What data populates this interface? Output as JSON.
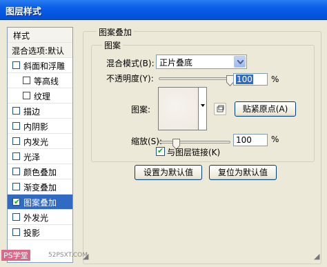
{
  "window": {
    "title": "图层样式"
  },
  "styles_panel": {
    "header_label": "样式",
    "blend_label": "混合选项:默认",
    "items": [
      {
        "label": "斜面和浮雕",
        "checked": false,
        "indent": false,
        "selected": false
      },
      {
        "label": "等高线",
        "checked": false,
        "indent": true,
        "selected": false
      },
      {
        "label": "纹理",
        "checked": false,
        "indent": true,
        "selected": false
      },
      {
        "label": "描边",
        "checked": false,
        "indent": false,
        "selected": false
      },
      {
        "label": "内阴影",
        "checked": false,
        "indent": false,
        "selected": false
      },
      {
        "label": "内发光",
        "checked": false,
        "indent": false,
        "selected": false
      },
      {
        "label": "光泽",
        "checked": false,
        "indent": false,
        "selected": false
      },
      {
        "label": "颜色叠加",
        "checked": false,
        "indent": false,
        "selected": false
      },
      {
        "label": "渐变叠加",
        "checked": false,
        "indent": false,
        "selected": false
      },
      {
        "label": "图案叠加",
        "checked": true,
        "indent": false,
        "selected": true
      },
      {
        "label": "外发光",
        "checked": false,
        "indent": false,
        "selected": false
      },
      {
        "label": "投影",
        "checked": false,
        "indent": false,
        "selected": false
      }
    ]
  },
  "pattern_overlay": {
    "group_title": "图案叠加",
    "subgroup_title": "图案",
    "blend_mode_label": "混合模式(B):",
    "blend_mode_value": "正片叠底",
    "opacity_label": "不透明度(Y):",
    "opacity_value": "100",
    "opacity_percent": 1.0,
    "opacity_unit": "%",
    "pattern_label": "图案:",
    "snap_origin_button": "贴紧原点(A)",
    "scale_label": "缩放(S):",
    "scale_value": "100",
    "scale_percent": 1.0,
    "scale_unit": "%",
    "link_with_layer_label": "与图层链接(K)",
    "link_with_layer_checked": true
  },
  "buttons": {
    "make_default": "设置为默认值",
    "reset_default": "复位为默认值"
  },
  "watermark": {
    "logo_text": "PS学堂",
    "site_text": "52PSXT.COM"
  }
}
